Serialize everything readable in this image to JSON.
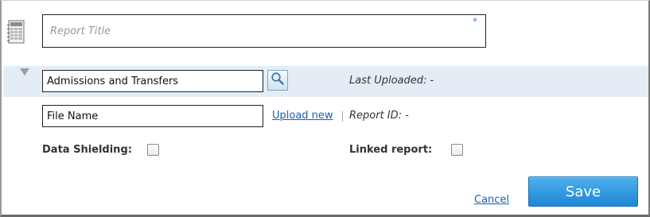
{
  "title_row": {
    "icon": "report-grid-icon",
    "title_placeholder": "Report Title",
    "required_marker": "*"
  },
  "report_row": {
    "collapse_icon": "triangle-down-icon",
    "report_type_value": "Admissions and Transfers",
    "search_icon": "magnifier-icon",
    "last_uploaded": "Last Uploaded: -"
  },
  "file_row": {
    "file_name_value": "File Name",
    "upload_label": "Upload new",
    "report_id": "Report ID: -"
  },
  "options": {
    "data_shielding_label": "Data Shielding:",
    "data_shielding_checked": false,
    "linked_report_label": "Linked report:",
    "linked_report_checked": false
  },
  "actions": {
    "cancel_label": "Cancel",
    "save_label": "Save"
  },
  "colors": {
    "band": "#e4edf6",
    "link": "#1a5fb4",
    "save_button": "#2b95de",
    "required_marker": "#3a82d8"
  }
}
